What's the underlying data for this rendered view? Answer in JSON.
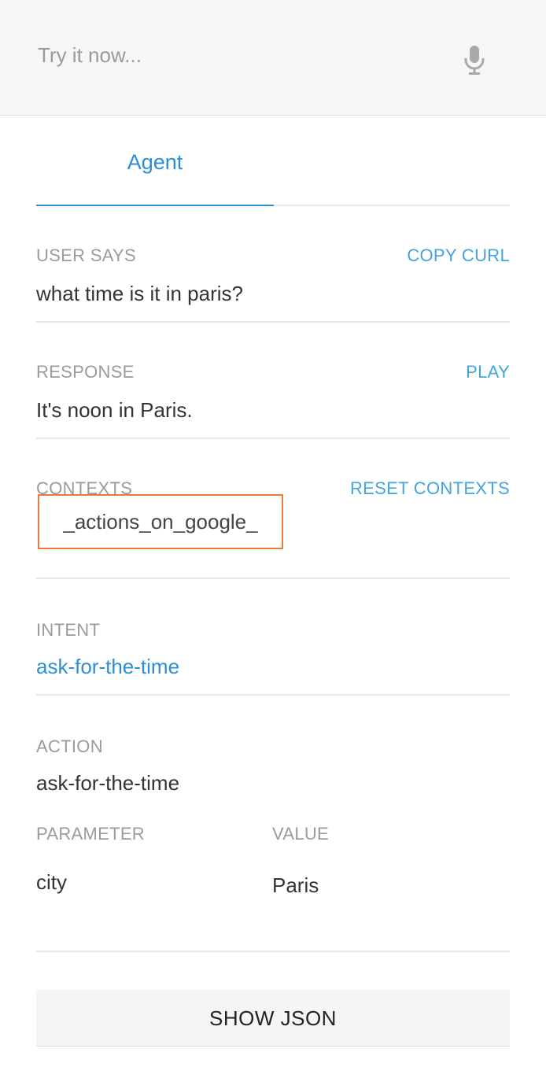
{
  "try_bar": {
    "placeholder": "Try it now...",
    "mic_icon": "microphone-icon"
  },
  "tabs": [
    {
      "label": "Agent",
      "active": true
    }
  ],
  "user_says": {
    "label": "USER SAYS",
    "action": "COPY CURL",
    "value": "what time is it in paris?"
  },
  "response": {
    "label": "RESPONSE",
    "action": "PLAY",
    "value": "It's noon in Paris."
  },
  "contexts": {
    "label": "CONTEXTS",
    "action": "RESET CONTEXTS",
    "items": [
      "_actions_on_google_"
    ]
  },
  "intent": {
    "label": "INTENT",
    "value": "ask-for-the-time"
  },
  "action": {
    "label": "ACTION",
    "value": "ask-for-the-time",
    "parameter_header": "PARAMETER",
    "value_header": "VALUE",
    "parameters": [
      {
        "name": "city",
        "value": "Paris"
      }
    ]
  },
  "show_json_label": "SHOW JSON",
  "colors": {
    "accent": "#2a8fd6",
    "context_border": "#e57a3b",
    "label_gray": "#9b9b9b"
  }
}
